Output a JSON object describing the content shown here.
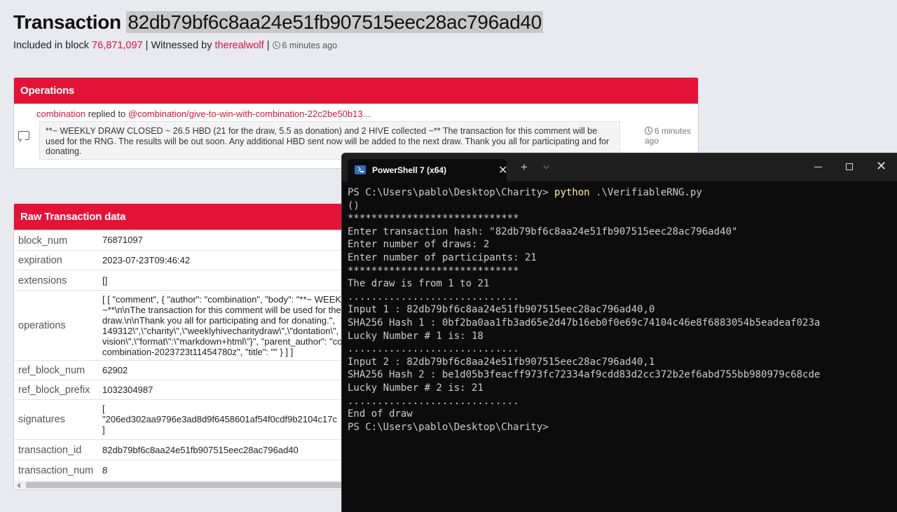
{
  "header": {
    "title_prefix": "Transaction",
    "tx_hash": "82db79bf6c8aa24e51fb907515eec28ac796ad40",
    "included_label": "Included in block",
    "block_number": "76,871,097",
    "witnessed_label": "| Witnessed by",
    "witness": "therealwolf",
    "separator": "|",
    "time_ago": "6 minutes ago"
  },
  "operations": {
    "title": "Operations",
    "author": "combination",
    "replied_to_label": "replied to",
    "reply_target": "@combination/give-to-win-with-combination-22c2be50b13...",
    "body": "**~ WEEKLY DRAW CLOSED ~ 26.5 HBD (21 for the draw, 5.5 as donation) and 2 HIVE collected ~** The transaction for this comment will be used for the RNG. The results will be out soon. Any additional HBD sent now will be added to the next draw. Thank you all for participating and for donating.",
    "time_ago_line1": "6 minutes",
    "time_ago_line2": "ago"
  },
  "raw": {
    "title": "Raw Transaction data",
    "rows": [
      {
        "key": "block_num",
        "lines": [
          "76871097"
        ]
      },
      {
        "key": "expiration",
        "lines": [
          "2023-07-23T09:46:42"
        ]
      },
      {
        "key": "extensions",
        "lines": [
          "[]"
        ]
      },
      {
        "key": "operations",
        "lines": [
          "[ [ \"comment\", { \"author\": \"combination\", \"body\": \"**~ WEEKLY DRAW",
          "~**\\n\\nThe transaction for this comment will be used for the",
          "draw.\\n\\nThank you all for participating and for donating.\",",
          "149312\\\",\\\"charity\\\",\\\"weeklyhivecharitydraw\\\",\\\"dontation\\\",",
          "vision\\\",\\\"format\\\":\\\"markdown+html\\\"}\", \"parent_author\": \"co",
          "combination-2023723t11454780z\", \"title\": \"\" } ] ]"
        ]
      },
      {
        "key": "ref_block_num",
        "lines": [
          "62902"
        ]
      },
      {
        "key": "ref_block_prefix",
        "lines": [
          "1032304987"
        ]
      },
      {
        "key": "signatures",
        "lines": [
          "[",
          "\"206ed302aa9796e3ad8d9f6458601af54f0cdf9b2104c17c",
          "]"
        ]
      },
      {
        "key": "transaction_id",
        "lines": [
          "82db79bf6c8aa24e51fb907515eec28ac796ad40"
        ]
      },
      {
        "key": "transaction_num",
        "lines": [
          "8"
        ]
      }
    ]
  },
  "terminal": {
    "tab_title": "PowerShell 7 (x64)",
    "prompt": "PS C:\\Users\\pablo\\Desktop\\Charity>",
    "command": "python",
    "command_arg": ".\\VerifiableRNG.py",
    "lines": [
      "()",
      "*****************************",
      "Enter transaction hash: \"82db79bf6c8aa24e51fb907515eec28ac796ad40\"",
      "Enter number of draws: 2",
      "Enter number of participants: 21",
      "*****************************",
      "The draw is from 1 to 21",
      ".............................",
      "Input 1 : 82db79bf6c8aa24e51fb907515eec28ac796ad40,0",
      "SHA256 Hash 1 : 0bf2ba0aa1fb3ad65e2d47b16eb0f0e69c74104c46e8f6883054b5eadeaf023a",
      "Lucky Number # 1 is: 18",
      ".............................",
      "Input 2 : 82db79bf6c8aa24e51fb907515eec28ac796ad40,1",
      "SHA256 Hash 2 : be1d05b3feacff973fc72334af9cdd83d2cc372b2ef6abd755bb980979c68cde",
      "Lucky Number # 2 is: 21",
      ".............................",
      "End of draw"
    ],
    "final_prompt": "PS C:\\Users\\pablo\\Desktop\\Charity>"
  },
  "colors": {
    "accent": "#e31337",
    "link": "#d8143a",
    "terminal_bg": "#0c0c0c",
    "command_yellow": "#f9f1a5"
  }
}
